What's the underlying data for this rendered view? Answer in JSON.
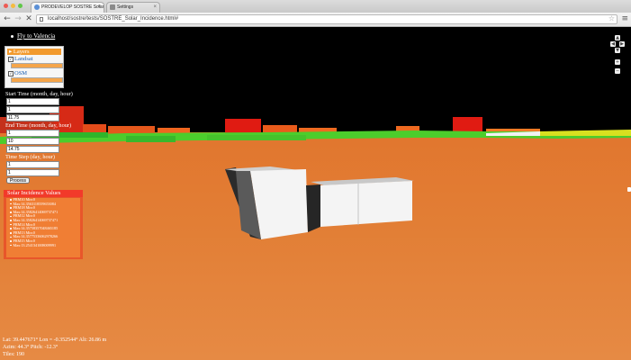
{
  "browser": {
    "tabs": [
      {
        "label": "PRODEVELOP SOSTRE Solar",
        "active": true
      },
      {
        "label": "Settings",
        "active": false
      }
    ],
    "url": "localhost/sostre/tests/SOSTRE_Solar_Incidence.html#",
    "colors": {
      "close": "#ee5b54",
      "minimize": "#f5bb40",
      "maximize": "#5fc748"
    }
  },
  "page": {
    "fly_to": "Fly to Valencia",
    "layers": {
      "title": "Layers",
      "items": [
        {
          "label": "Landsat",
          "checked": true,
          "opacity": 1.0
        },
        {
          "label": "OSM",
          "checked": true,
          "opacity": 1.0
        }
      ]
    },
    "form": {
      "start_label": "Start Time (month, day, hour)",
      "start_values": [
        "1",
        "1",
        "11.75"
      ],
      "end_label": "End Time (month, day, hour)",
      "end_values": [
        "1",
        "10",
        "14.75"
      ],
      "step_label": "Time Step (day, hour)",
      "step_values": [
        "1",
        "1"
      ],
      "process_label": "Process"
    },
    "results": {
      "title": "Solar Incidence Values",
      "items": [
        "PRM10 Min:0",
        "Max:14.3563118559653084",
        "PRM18 Min:0",
        "Max:14.35826414069737471",
        "PRM12 Min:0",
        "Max:14.35826414069737471",
        "PRM14 Min:0",
        "Max:14.35758357048465185",
        "PRM13 Min:0",
        "Max:14.35775336062978266",
        "PRM15 Min:0",
        "Max:13.2541341008009991"
      ]
    },
    "status": {
      "line1": "Lat: 39.447671° Lon = -0.352544° Alt: 26.86 m",
      "line2": "Azim: 44.3° Pitch: -12.3°",
      "line3": "Tiles: 190"
    },
    "nav_icons": [
      "pan-up-icon",
      "pan-left-icon",
      "pan-right-icon",
      "pan-down-icon",
      "zoom-in-icon",
      "zoom-out-icon"
    ]
  }
}
